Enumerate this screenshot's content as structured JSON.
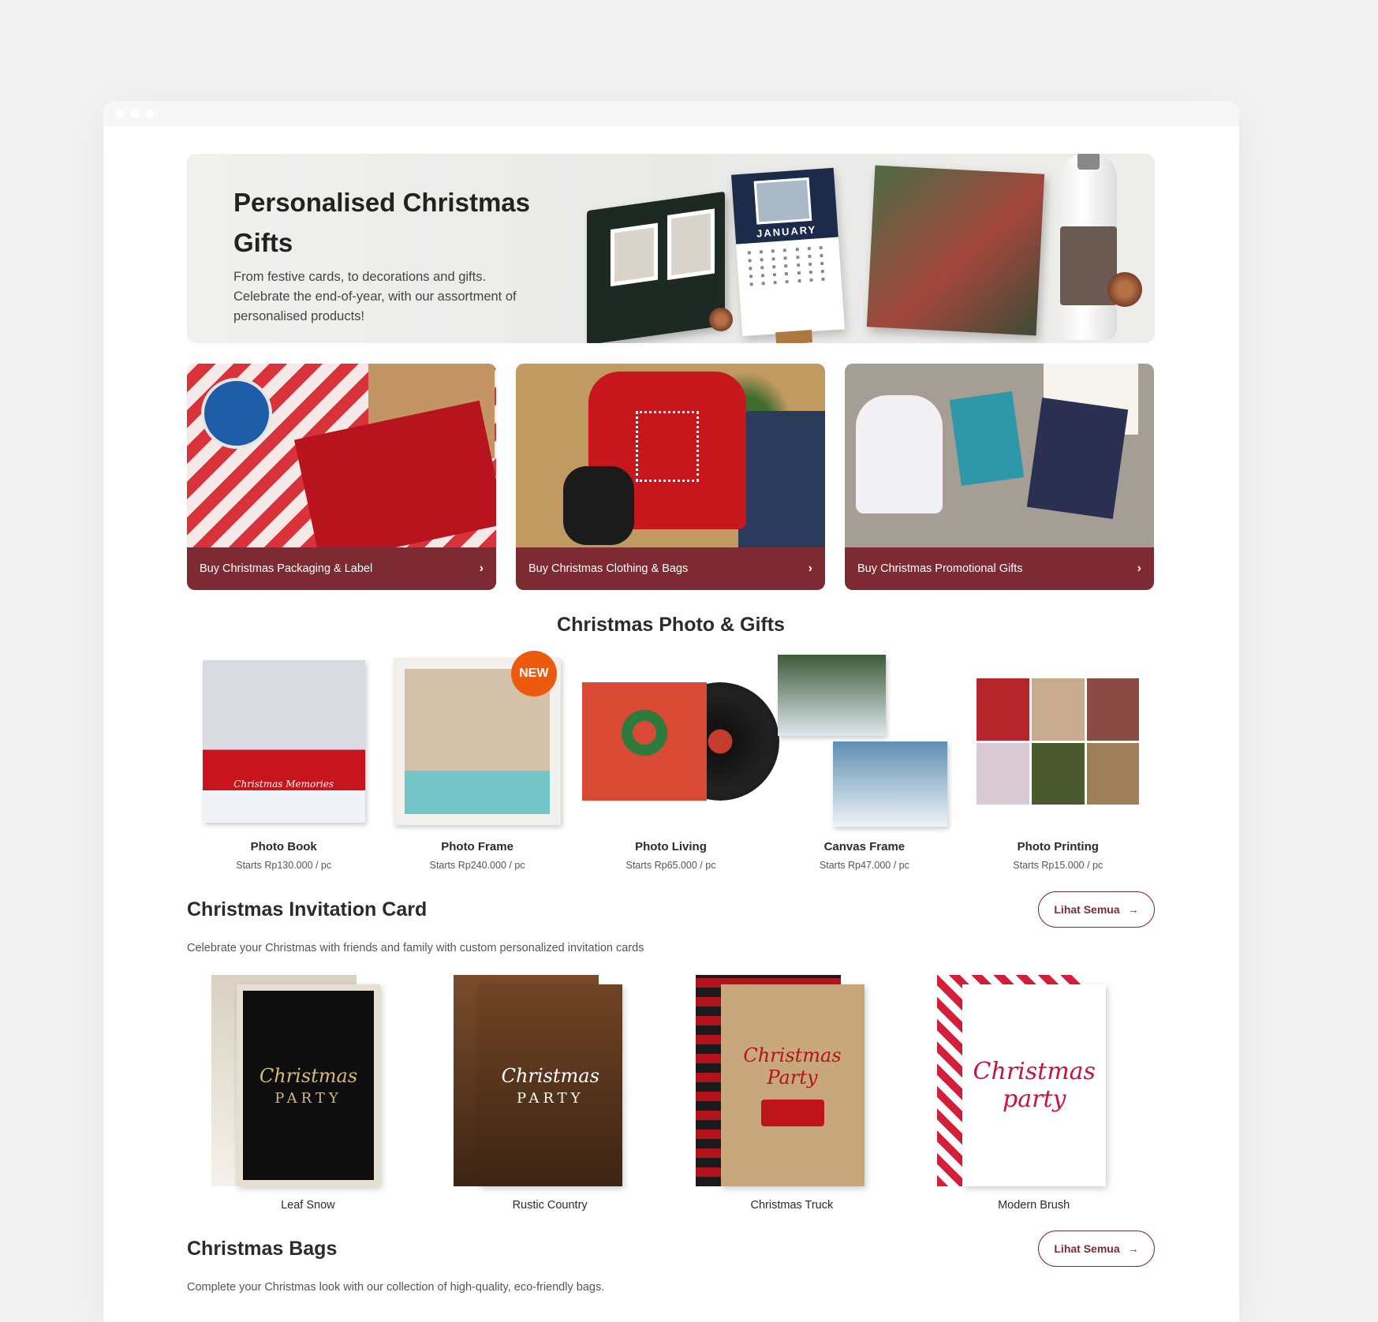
{
  "hero": {
    "title": "Personalised Christmas Gifts",
    "description": "From festive cards, to decorations and gifts. Celebrate the end-of-year, with our assortment of personalised products!",
    "calendar_month": "JANUARY"
  },
  "categories": [
    {
      "label": "Buy Christmas Packaging & Label"
    },
    {
      "label": "Buy Christmas Clothing & Bags"
    },
    {
      "label": "Buy Christmas Promotional Gifts"
    }
  ],
  "photo_gifts": {
    "title": "Christmas Photo & Gifts",
    "badge": "NEW",
    "book_label": "Christmas Memories",
    "items": [
      {
        "name": "Photo Book",
        "price": "Starts Rp130.000 / pc"
      },
      {
        "name": "Photo Frame",
        "price": "Starts Rp240.000 / pc"
      },
      {
        "name": "Photo Living",
        "price": "Starts Rp65.000 / pc"
      },
      {
        "name": "Canvas Frame",
        "price": "Starts Rp47.000 / pc"
      },
      {
        "name": "Photo Printing",
        "price": "Starts Rp15.000 / pc"
      }
    ]
  },
  "invitations": {
    "title": "Christmas Invitation Card",
    "see_all": "Lihat Semua",
    "description": "Celebrate your Christmas with friends and family with custom personalized invitation cards",
    "items": [
      {
        "name": "Leaf Snow",
        "line1": "Christmas",
        "line2": "PARTY"
      },
      {
        "name": "Rustic Country",
        "line1": "Christmas",
        "line2": "PARTY"
      },
      {
        "name": "Christmas Truck",
        "line1": "Christmas",
        "line2": "Party"
      },
      {
        "name": "Modern Brush",
        "line1": "Christmas",
        "line2": "party"
      }
    ]
  },
  "bags": {
    "title": "Christmas Bags",
    "see_all": "Lihat Semua",
    "description": "Complete your Christmas look with our collection of high-quality, eco-friendly bags."
  },
  "colors": {
    "accent": "#7e2a32",
    "badge": "#ec5a0d",
    "background": "#f2f2f3"
  },
  "icons": {
    "chevron": "chevron-right-icon",
    "arrow": "arrow-right-icon"
  }
}
